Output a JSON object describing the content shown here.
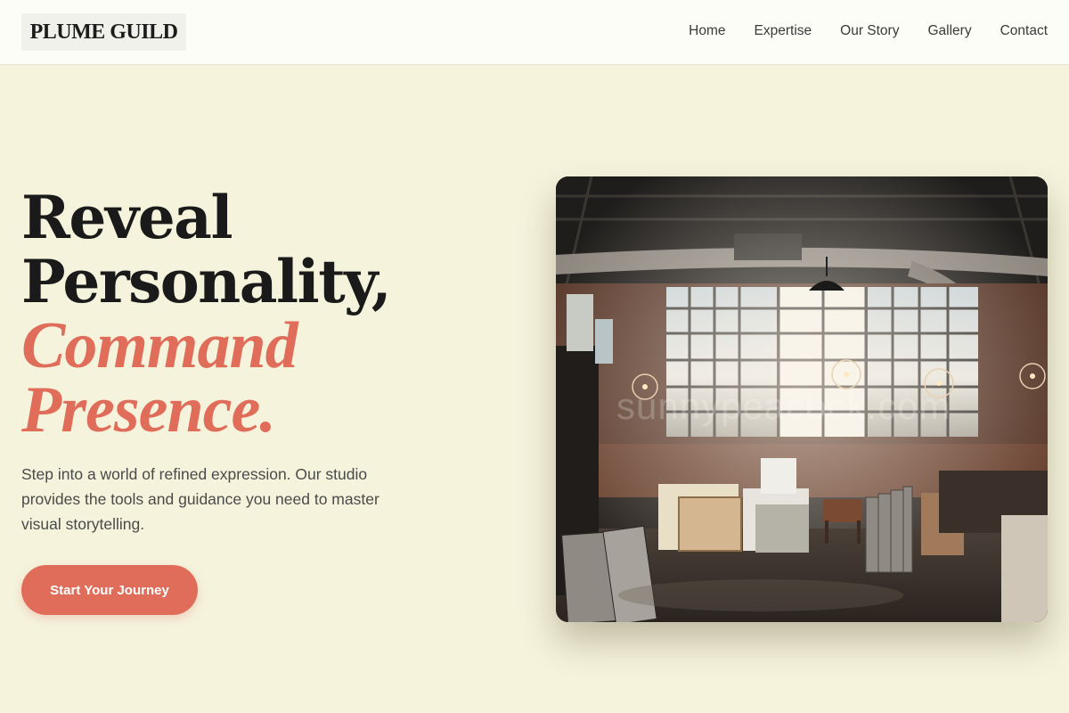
{
  "brand": {
    "logo_text": "PLUME GUILD"
  },
  "nav": {
    "items": [
      {
        "label": "Home"
      },
      {
        "label": "Expertise"
      },
      {
        "label": "Our Story"
      },
      {
        "label": "Gallery"
      },
      {
        "label": "Contact"
      }
    ]
  },
  "hero": {
    "title_line1": "Reveal",
    "title_line2": "Personality,",
    "title_accent_line1": "Command",
    "title_accent_line2": "Presence.",
    "description": "Step into a world of refined expression. Our studio provides the tools and guidance you need to master visual storytelling.",
    "cta_label": "Start Your Journey"
  },
  "image": {
    "subject": "industrial art studio loft with large windows, chandeliers and stacked canvases",
    "watermark": "sunnypeacock.com"
  },
  "colors": {
    "background": "#f5f3dc",
    "header_bg": "#fdfdf8",
    "accent": "#e06d5a",
    "text_dark": "#1a1a1a",
    "text_body": "#4a4a4a"
  }
}
